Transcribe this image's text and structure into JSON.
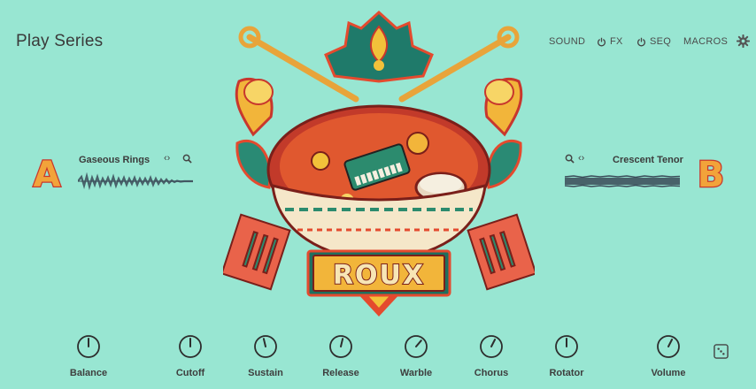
{
  "header": {
    "title": "Play Series",
    "nav": [
      {
        "label": "SOUND",
        "power": false
      },
      {
        "label": "FX",
        "power": true
      },
      {
        "label": "SEQ",
        "power": true
      },
      {
        "label": "MACROS",
        "power": false
      }
    ]
  },
  "layers": {
    "a": {
      "letter": "A",
      "preset": "Gaseous Rings",
      "nav_icon": "‹›"
    },
    "b": {
      "letter": "B",
      "preset": "Crescent Tenor",
      "nav_icon": "‹›"
    }
  },
  "artwork": {
    "logo_text": "ROUX"
  },
  "knobs": [
    {
      "label": "Balance",
      "value": 0.5
    },
    {
      "label": "Cutoff",
      "value": 0.5
    },
    {
      "label": "Sustain",
      "value": 0.45
    },
    {
      "label": "Release",
      "value": 0.55
    },
    {
      "label": "Warble",
      "value": 0.65
    },
    {
      "label": "Chorus",
      "value": 0.6
    },
    {
      "label": "Rotator",
      "value": 0.5
    },
    {
      "label": "Volume",
      "value": 0.6
    }
  ],
  "colors": {
    "background": "#98e6d2",
    "letter_fill": "#f2a33a",
    "letter_outline": "#c8372d",
    "text": "#3a3a3a"
  },
  "icons": [
    "power-icon",
    "gear-icon",
    "search-icon",
    "dice-icon"
  ]
}
